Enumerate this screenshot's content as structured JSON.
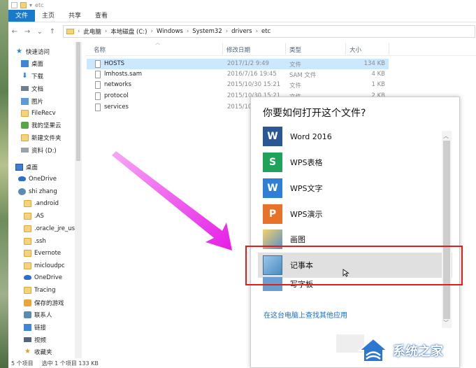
{
  "window": {
    "title_path": "etc",
    "ribbon_tabs": [
      "文件",
      "主页",
      "共享",
      "查看"
    ]
  },
  "address_bar": {
    "segments": [
      "此电脑",
      "本地磁盘 (C:)",
      "Windows",
      "System32",
      "drivers",
      "etc"
    ]
  },
  "nav_pane": {
    "items": [
      {
        "label": "快速访问",
        "icon": "star-icon"
      },
      {
        "label": "桌面",
        "icon": "folder-icon",
        "pinned": true
      },
      {
        "label": "下载",
        "icon": "download-icon",
        "pinned": true
      },
      {
        "label": "文档",
        "icon": "document-icon",
        "pinned": true
      },
      {
        "label": "图片",
        "icon": "picture-icon",
        "pinned": true
      },
      {
        "label": "FileRecv",
        "icon": "folder-icon"
      },
      {
        "label": "我的坚果云",
        "icon": "nutstore-icon"
      },
      {
        "label": "新建文件夹",
        "icon": "folder-icon"
      },
      {
        "label": "资料 (D:)",
        "icon": "drive-icon"
      },
      {
        "label": "桌面",
        "icon": "desktop-icon"
      },
      {
        "label": "OneDrive",
        "icon": "onedrive-icon"
      },
      {
        "label": "shi zhang",
        "icon": "user-icon"
      },
      {
        "label": ".android",
        "icon": "folder-icon"
      },
      {
        "label": ".AS",
        "icon": "folder-icon"
      },
      {
        "label": ".oracle_jre_us",
        "icon": "folder-icon"
      },
      {
        "label": ".ssh",
        "icon": "folder-icon"
      },
      {
        "label": "Evernote",
        "icon": "folder-icon"
      },
      {
        "label": "micloudpc",
        "icon": "folder-icon"
      },
      {
        "label": "OneDrive",
        "icon": "onedrive-icon"
      },
      {
        "label": "Tracing",
        "icon": "folder-icon"
      },
      {
        "label": "保存的游戏",
        "icon": "saved-games-icon"
      },
      {
        "label": "联系人",
        "icon": "contacts-icon"
      },
      {
        "label": "链接",
        "icon": "links-icon"
      },
      {
        "label": "视频",
        "icon": "video-icon"
      },
      {
        "label": "收藏夹",
        "icon": "favorites-icon"
      }
    ]
  },
  "file_list": {
    "columns": {
      "name": "名称",
      "date": "修改日期",
      "type": "类型",
      "size": "大小"
    },
    "rows": [
      {
        "name": "HOSTS",
        "date": "2017/1/2 9:49",
        "type": "文件",
        "size": "134 KB",
        "selected": true
      },
      {
        "name": "lmhosts.sam",
        "date": "2016/7/16 19:45",
        "type": "SAM 文件",
        "size": "4 KB"
      },
      {
        "name": "networks",
        "date": "2015/10/30 15:21",
        "type": "文件",
        "size": "1 KB"
      },
      {
        "name": "protocol",
        "date": "2015/10/30 15:21",
        "type": "文件",
        "size": "2 KB"
      },
      {
        "name": "services",
        "date": "2015/10",
        "type": "",
        "size": ""
      }
    ]
  },
  "status_bar": {
    "item_count": "5 个项目",
    "selection": "选中 1 个项目  133 KB"
  },
  "open_with_dialog": {
    "title": "你要如何打开这个文件?",
    "apps": [
      {
        "name": "Word 2016",
        "icon": "word-icon",
        "color": "#2b5797"
      },
      {
        "name": "WPS表格",
        "icon": "wps-spreadsheet-icon",
        "color": "#1fa25a"
      },
      {
        "name": "WPS文字",
        "icon": "wps-writer-icon",
        "color": "#2f7fd9"
      },
      {
        "name": "WPS演示",
        "icon": "wps-presentation-icon",
        "color": "#e8722a"
      },
      {
        "name": "画图",
        "icon": "paint-icon",
        "color": "#5a8fc8"
      },
      {
        "name": "记事本",
        "icon": "notepad-icon",
        "color": "#4b8bc0",
        "highlighted": true
      },
      {
        "name": "写字板",
        "icon": "wordpad-icon",
        "color": "#6a9ed3"
      }
    ],
    "more_apps_link": "在这台电脑上查找其他应用"
  },
  "watermark": {
    "text": "系统之家"
  },
  "colors": {
    "accent": "#1979ca",
    "selection": "#cce8ff",
    "annotation_red": "#e21b1b",
    "annotation_arrow": "#e61de6",
    "link": "#1a6ec7"
  }
}
